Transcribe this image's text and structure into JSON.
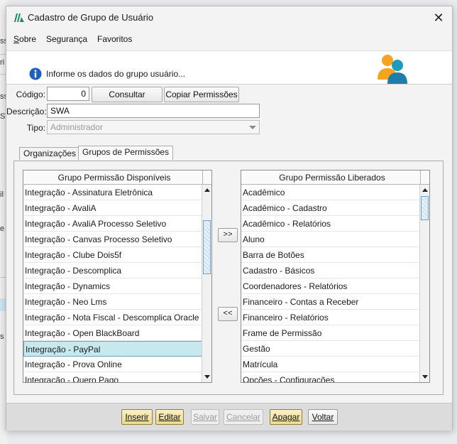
{
  "window": {
    "title": "Cadastro de Grupo de Usuário"
  },
  "menu": [
    {
      "label": "Sobre",
      "mnemonic": "S"
    },
    {
      "label": "Segurança"
    },
    {
      "label": "Favoritos"
    }
  ],
  "info": {
    "text": "Informe os dados do grupo usuário..."
  },
  "form": {
    "codigo_label": "Código:",
    "codigo_value": "0",
    "consultar_label": "Consultar",
    "copiar_label": "Copiar Permissões",
    "descricao_label": "Descrição:",
    "descricao_value": "SWA",
    "tipo_label": "Tipo:",
    "tipo_value": "Administrador"
  },
  "tabs": [
    {
      "label": "Organizações",
      "active": false
    },
    {
      "label": "Grupos de Permissões",
      "active": true
    }
  ],
  "available": {
    "header": "Grupo Permissão Disponíveis",
    "items": [
      "Integração - Assinatura Eletrônica",
      "Integração - AvaliA",
      "Integração - AvaliA Processo Seletivo",
      "Integração - Canvas Processo Seletivo",
      "Integração - Clube Dois5f",
      "Integração - Descomplica",
      "Integração - Dynamics",
      "Integração - Neo Lms",
      "Integração - Nota Fiscal - Descomplica Oracle",
      "Integração - Open BlackBoard",
      "Integração - PayPal",
      "Integração - Prova Online",
      "Integração - Quero Pago"
    ],
    "selected": "Integração - PayPal"
  },
  "released": {
    "header": "Grupo Permissão Liberados",
    "items": [
      "Acadêmico",
      "Acadêmico - Cadastro",
      "Acadêmico - Relatórios",
      "Aluno",
      "Barra de Botões",
      "Cadastro - Básicos",
      "Coordenadores - Relatórios",
      "Financeiro - Contas a Receber",
      "Financeiro - Relatórios",
      "Frame de Permissão",
      "Gestão",
      "Matrícula",
      "Opções - Configurações"
    ]
  },
  "transfer": {
    "add_label": ">>",
    "remove_label": "<<"
  },
  "actions": {
    "inserir": "Inserir",
    "editar": "Editar",
    "salvar": "Salvar",
    "cancelar": "Cancelar",
    "apagar": "Apagar",
    "voltar": "Voltar"
  },
  "background_fragments": [
    "ss",
    "ri",
    "ss",
    "SV",
    "il",
    "e",
    "s"
  ],
  "colors": {
    "selected_row": "#c7e9ee",
    "active_button": "#eed98c",
    "info_icon": "#1f5fbf",
    "logo": "#1a8a6a"
  }
}
